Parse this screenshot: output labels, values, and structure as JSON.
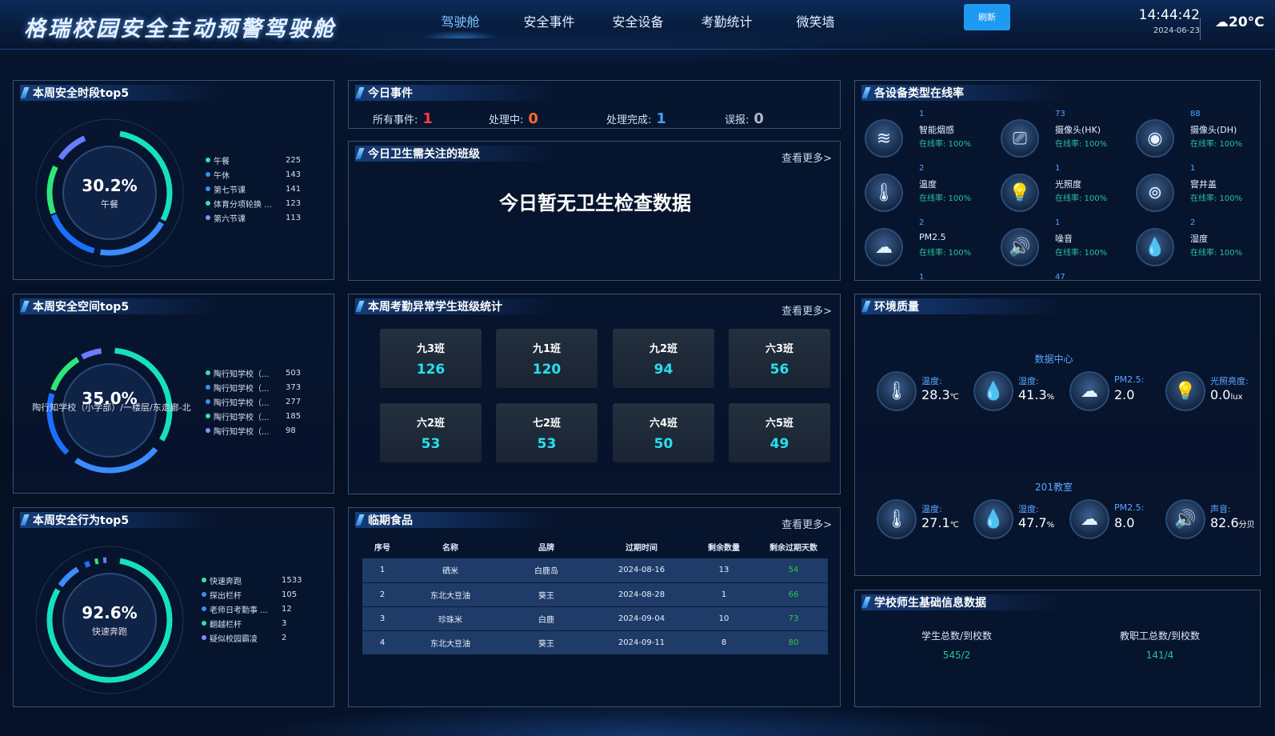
{
  "header": {
    "title": "格瑞校园安全主动预警驾驶舱",
    "nav": [
      "驾驶舱",
      "安全事件",
      "安全设备",
      "考勤统计",
      "微笑墙"
    ],
    "refresh": "刷新",
    "time": "14:44:42",
    "date": "2024-06-23",
    "weather": "20°C",
    "weather_icon": "cloud-icon"
  },
  "safe_time": {
    "title": "本周安全时段top5",
    "center_value": "30.2%",
    "center_label": "午餐",
    "items": [
      {
        "label": "午餐",
        "value": "225",
        "color": "#2ee6a6"
      },
      {
        "label": "午休",
        "value": "143",
        "color": "#3c8cff"
      },
      {
        "label": "第七节课",
        "value": "141",
        "color": "#3c8cff"
      },
      {
        "label": "体育分项轮换 ...",
        "value": "123",
        "color": "#2ee6a6"
      },
      {
        "label": "第六节课",
        "value": "113",
        "color": "#8a8cff"
      }
    ]
  },
  "safe_space": {
    "title": "本周安全空间top5",
    "center_value": "35.0%",
    "center_label": "陶行知学校（小学部）/一楼层/东走廊-北",
    "items": [
      {
        "label": "陶行知学校（...",
        "value": "503",
        "color": "#2ee6a6"
      },
      {
        "label": "陶行知学校（...",
        "value": "373",
        "color": "#3c8cff"
      },
      {
        "label": "陶行知学校（...",
        "value": "277",
        "color": "#3c8cff"
      },
      {
        "label": "陶行知学校（...",
        "value": "185",
        "color": "#2ee6a6"
      },
      {
        "label": "陶行知学校（...",
        "value": "98",
        "color": "#8a8cff"
      }
    ]
  },
  "safe_behavior": {
    "title": "本周安全行为top5",
    "center_value": "92.6%",
    "center_label": "快速奔跑",
    "items": [
      {
        "label": "快速奔跑",
        "value": "1533",
        "color": "#2ee6a6"
      },
      {
        "label": "探出栏杆",
        "value": "105",
        "color": "#3c8cff"
      },
      {
        "label": "老师日考勤事 ...",
        "value": "12",
        "color": "#3c8cff"
      },
      {
        "label": "翻越栏杆",
        "value": "3",
        "color": "#2ee6a6"
      },
      {
        "label": "疑似校园霸凌",
        "value": "2",
        "color": "#8a8cff"
      }
    ]
  },
  "today_events": {
    "title": "今日事件",
    "items": [
      {
        "label": "所有事件:",
        "value": "1",
        "color": "#ff3d3d"
      },
      {
        "label": "处理中:",
        "value": "0",
        "color": "#ff6a2a"
      },
      {
        "label": "处理完成:",
        "value": "1",
        "color": "#3ca0ff"
      },
      {
        "label": "误报:",
        "value": "0",
        "color": "#b0b8c8"
      }
    ]
  },
  "hygiene": {
    "title": "今日卫生需关注的班级",
    "more": "查看更多>",
    "empty": "今日暂无卫生检查数据"
  },
  "attendance": {
    "title": "本周考勤异常学生班级统计",
    "more": "查看更多>",
    "classes": [
      {
        "name": "九3班",
        "count": "126"
      },
      {
        "name": "九1班",
        "count": "120"
      },
      {
        "name": "九2班",
        "count": "94"
      },
      {
        "name": "六3班",
        "count": "56"
      },
      {
        "name": "六2班",
        "count": "53"
      },
      {
        "name": "七2班",
        "count": "53"
      },
      {
        "name": "六4班",
        "count": "50"
      },
      {
        "name": "六5班",
        "count": "49"
      }
    ]
  },
  "food": {
    "title": "临期食品",
    "more": "查看更多>",
    "columns": [
      "序号",
      "名称",
      "品牌",
      "过期时间",
      "剩余数量",
      "剩余过期天数"
    ],
    "rows": [
      [
        "1",
        "硒米",
        "白鹿岛",
        "2024-08-16",
        "13",
        "54"
      ],
      [
        "2",
        "东北大豆油",
        "葵王",
        "2024-08-28",
        "1",
        "66"
      ],
      [
        "3",
        "珍珠米",
        "白鹿",
        "2024-09-04",
        "10",
        "73"
      ],
      [
        "4",
        "东北大豆油",
        "葵王",
        "2024-09-11",
        "8",
        "80"
      ]
    ]
  },
  "devices": {
    "title": "各设备类型在线率",
    "items": [
      {
        "count": "1",
        "name": "智能烟感",
        "rate": "在线率: 100%",
        "icon": "smoke-detector-icon"
      },
      {
        "count": "73",
        "name": "摄像头(HK)",
        "rate": "在线率: 100%",
        "icon": "camera-icon"
      },
      {
        "count": "88",
        "name": "摄像头(DH)",
        "rate": "在线率: 100%",
        "icon": "dome-camera-icon"
      },
      {
        "count": "2",
        "name": "温度",
        "rate": "在线率: 100%",
        "icon": "thermometer-icon"
      },
      {
        "count": "1",
        "name": "光照度",
        "rate": "在线率: 100%",
        "icon": "light-bulb-icon"
      },
      {
        "count": "1",
        "name": "窨井盖",
        "rate": "在线率: 100%",
        "icon": "manhole-icon"
      },
      {
        "count": "2",
        "name": "PM2.5",
        "rate": "在线率: 100%",
        "icon": "cloud-icon"
      },
      {
        "count": "1",
        "name": "噪音",
        "rate": "在线率: 100%",
        "icon": "speaker-icon"
      },
      {
        "count": "2",
        "name": "湿度",
        "rate": "在线率: 100%",
        "icon": "humidity-icon"
      }
    ],
    "cut_counts": [
      "1",
      "47"
    ]
  },
  "environment": {
    "title": "环境质量",
    "groups": [
      {
        "name": "数据中心",
        "items": [
          {
            "label": "温度:",
            "value": "28.3",
            "unit": "℃",
            "icon": "thermometer-icon"
          },
          {
            "label": "湿度:",
            "value": "41.3",
            "unit": "%",
            "icon": "humidity-icon"
          },
          {
            "label": "PM2.5:",
            "value": "2.0",
            "unit": "",
            "icon": "cloud-icon"
          },
          {
            "label": "光照亮度:",
            "value": "0.0",
            "unit": "lux",
            "icon": "light-bulb-icon"
          }
        ]
      },
      {
        "name": "201教室",
        "items": [
          {
            "label": "温度:",
            "value": "27.1",
            "unit": "℃",
            "icon": "thermometer-icon"
          },
          {
            "label": "湿度:",
            "value": "47.7",
            "unit": "%",
            "icon": "humidity-icon"
          },
          {
            "label": "PM2.5:",
            "value": "8.0",
            "unit": "",
            "icon": "cloud-icon"
          },
          {
            "label": "声音:",
            "value": "82.6",
            "unit": "分贝",
            "icon": "speaker-icon"
          }
        ]
      }
    ]
  },
  "school_info": {
    "title": "学校师生基础信息数据",
    "items": [
      {
        "label": "学生总数/到校数",
        "value": "545/2"
      },
      {
        "label": "教职工总数/到校数",
        "value": "141/4"
      }
    ]
  }
}
